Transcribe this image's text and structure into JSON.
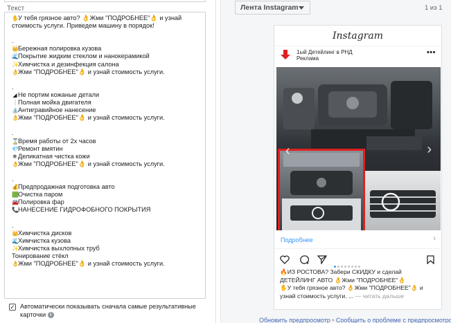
{
  "left_panel": {
    "field_label": "Текст",
    "text_lines": [
      {
        "icon": "✋",
        "text": "У тебя грязное авто? 👌Жми \"ПОДРОБНЕЕ\"👌 и узнай"
      },
      {
        "icon": "",
        "text": "стоимость услуги. Приведем машину в порядок!"
      },
      {
        "icon": "",
        "text": ""
      },
      {
        "icon": "",
        "text": "."
      },
      {
        "icon": "👑",
        "text": "Бережная полировка кузова"
      },
      {
        "icon": "🌊",
        "text": "Покрытие жидким стеклом и нанокерамикой"
      },
      {
        "icon": "✨",
        "text": "Химчистка и дезинфекция салона"
      },
      {
        "icon": "👌",
        "text": "Жми \"ПОДРОБНЕЕ\"👌 и узнай стоимость услуги."
      },
      {
        "icon": "",
        "text": ""
      },
      {
        "icon": "",
        "text": "."
      },
      {
        "icon": "◢",
        "text": "Не портим кожаные детали"
      },
      {
        "icon": "❕",
        "text": "Полная мойка двигателя"
      },
      {
        "icon": "⛲",
        "text": "Антигравийное нанесение"
      },
      {
        "icon": "👌",
        "text": "Жми \"ПОДРОБНЕЕ\"👌 и узнай стоимость услуги."
      },
      {
        "icon": "",
        "text": ""
      },
      {
        "icon": "",
        "text": "."
      },
      {
        "icon": "⌛",
        "text": "Время работы от 2х часов"
      },
      {
        "icon": "💎",
        "text": "Ремонт вмятин"
      },
      {
        "icon": "❄",
        "text": "Деликатная чистка кожи"
      },
      {
        "icon": "👌",
        "text": "Жми \"ПОДРОБНЕЕ\"👌 и узнай стоимость услуги."
      },
      {
        "icon": "",
        "text": ""
      },
      {
        "icon": "",
        "text": "."
      },
      {
        "icon": "💰",
        "text": "Предпродажная подготовка авто"
      },
      {
        "icon": "🟩",
        "text": "Очистка паром"
      },
      {
        "icon": "🚘",
        "text": "Полировка фар"
      },
      {
        "icon": "📞",
        "text": "НАНЕСЕНИЕ ГИДРОФОБНОГО ПОКРЫТИЯ"
      },
      {
        "icon": "",
        "text": ""
      },
      {
        "icon": "",
        "text": "."
      },
      {
        "icon": "👑",
        "text": "Химчистка дисков"
      },
      {
        "icon": "🌊",
        "text": "Химчистка кузова"
      },
      {
        "icon": "✨",
        "text": "Химчистка выхлопных труб"
      },
      {
        "icon": "",
        "text": "Тонирование стёкл"
      },
      {
        "icon": "👌",
        "text": "Жми \"ПОДРОБНЕЕ\"👌 и узнай стоимость услуги."
      }
    ],
    "checkbox_label": "Автоматически показывать сначала самые результативные карточки",
    "checkbox_checked": true
  },
  "preview": {
    "feed_select": "Лента Instagram",
    "pager": "1 из 1",
    "ig_logo": "Instagram",
    "account_name": "1ый Детейлинг в РНД",
    "sponsored": "Реклама",
    "more_link": "Подробнее",
    "caption": [
      "🔥ИЗ РОСТОВА? Забери СКИДКУ и сделай",
      "ДЕТЕЙЛИНГ АВТО 👌Жми \"ПОДРОБНЕЕ\"👌",
      "✋У тебя грязное авто? 👌Жми \"ПОДРОБНЕЕ\"👌 и",
      "узнай стоимость услуги. ... "
    ],
    "read_more": "— читать дальше",
    "carousel_dots": 8,
    "carousel_active": 1
  },
  "footer": {
    "link1": "Обновить предпросмотр",
    "separator": " • ",
    "link2": "Сообщить о проблеме с предпросмотром"
  },
  "colors": {
    "link_blue": "#4267b2",
    "ig_blue": "#3897f0",
    "border": "#ccd0d5",
    "arrow_red": "#e02020"
  }
}
